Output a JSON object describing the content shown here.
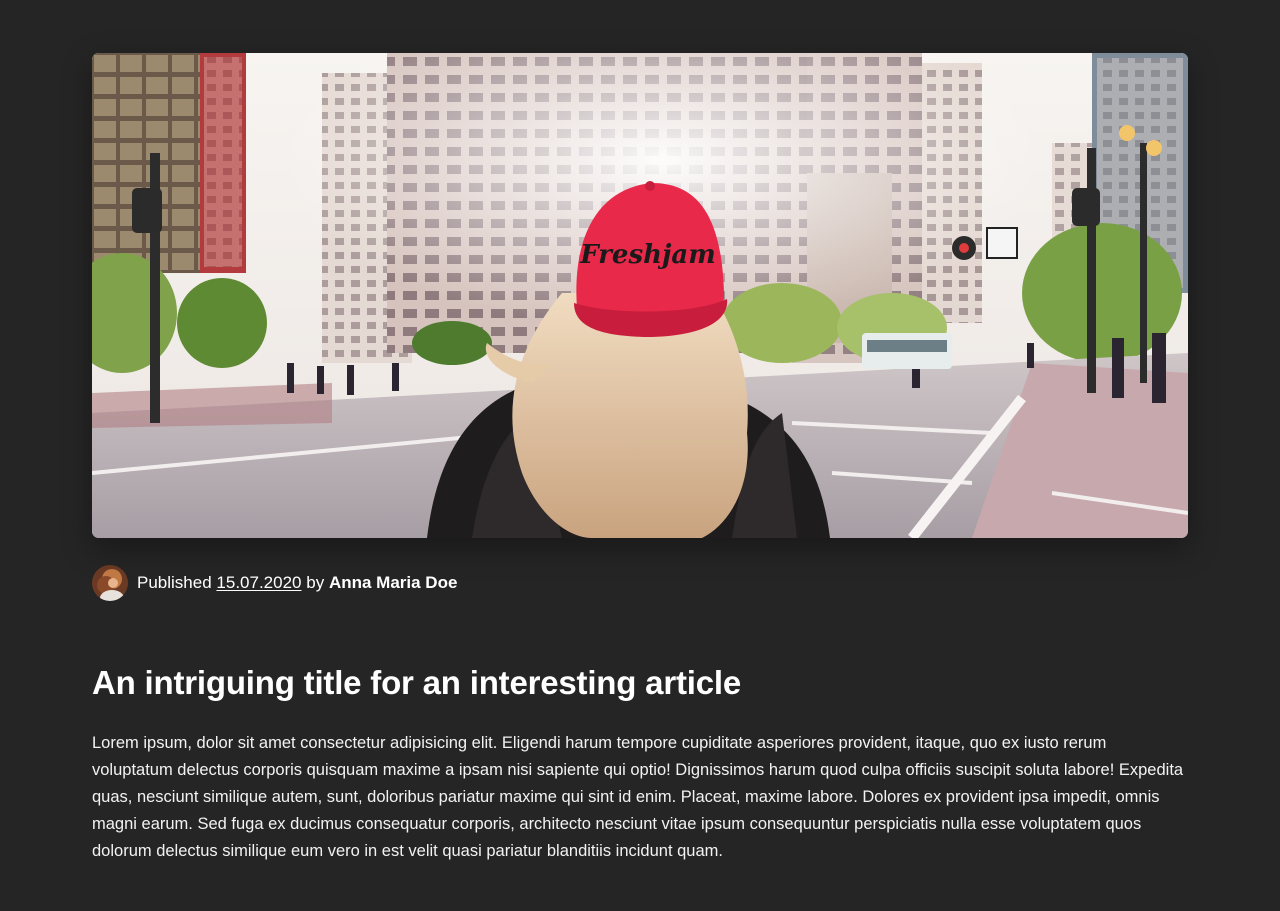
{
  "article": {
    "hero_image": {
      "description_icon": "city-street-photo",
      "cap_text": "Freshjam"
    },
    "meta": {
      "published_label": "Published",
      "date": "15.07.2020",
      "by_label": "by",
      "author": "Anna Maria Doe"
    },
    "title": "An intriguing title for an interesting article",
    "body": "Lorem ipsum, dolor sit amet consectetur adipisicing elit. Eligendi harum tempore cupiditate asperiores provident, itaque, quo ex iusto rerum voluptatum delectus corporis quisquam maxime a ipsam nisi sapiente qui optio! Dignissimos harum quod culpa officiis suscipit soluta labore! Expedita quas, nesciunt similique autem, sunt, doloribus pariatur maxime qui sint id enim. Placeat, maxime labore. Dolores ex provident ipsa impedit, omnis magni earum. Sed fuga ex ducimus consequatur corporis, architecto nesciunt vitae ipsum consequuntur perspiciatis nulla esse voluptatem quos dolorum delectus similique eum vero in est velit quasi pariatur blanditiis incidunt quam."
  },
  "colors": {
    "background": "#252525",
    "text": "#ffffff",
    "cap_red": "#e8294a"
  }
}
